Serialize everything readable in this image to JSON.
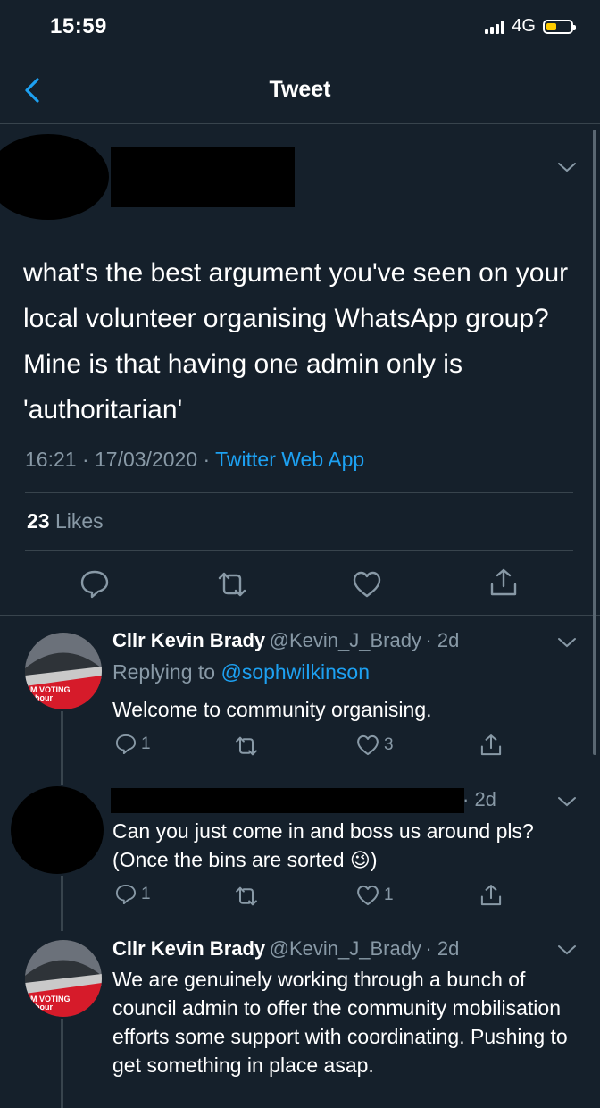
{
  "status": {
    "time": "15:59",
    "network": "4G"
  },
  "nav": {
    "title": "Tweet"
  },
  "tweet": {
    "text": "what's the best argument you've seen on your local volunteer organising WhatsApp group? Mine is that having one admin only is 'authoritarian'",
    "timestamp": "16:21 · 17/03/2020 · ",
    "source": "Twitter Web App",
    "likes_count": "23",
    "likes_label": "Likes"
  },
  "replies": [
    {
      "name": "Cllr Kevin Brady",
      "handle": "@Kevin_J_Brady",
      "time": "· 2d",
      "replying_prefix": "Replying to ",
      "replying_to": "@sophwilkinson",
      "text": "Welcome to community organising.",
      "reply_count": "1",
      "like_count": "3",
      "avatar_text": [
        "M VOTING",
        "abour"
      ]
    },
    {
      "time": "· 2d",
      "text_line1": "Can you just come in and boss us around pls?",
      "text_line2": "(Once the bins are sorted ",
      "text_line2_end": ")",
      "emoji": "😉",
      "reply_count": "1",
      "like_count": "1"
    },
    {
      "name": "Cllr Kevin Brady",
      "handle": "@Kevin_J_Brady",
      "time": "· 2d",
      "text": "We are genuinely working through a bunch of council admin to offer the community mobilisation efforts some support with coordinating. Pushing to get something in place asap.",
      "avatar_text": [
        "M VOTING",
        "abour"
      ]
    }
  ],
  "colors": {
    "background": "#15202b",
    "accent": "#1da1f2",
    "muted": "#8899a6",
    "divider": "#38444d",
    "battery": "#ffcc00"
  }
}
